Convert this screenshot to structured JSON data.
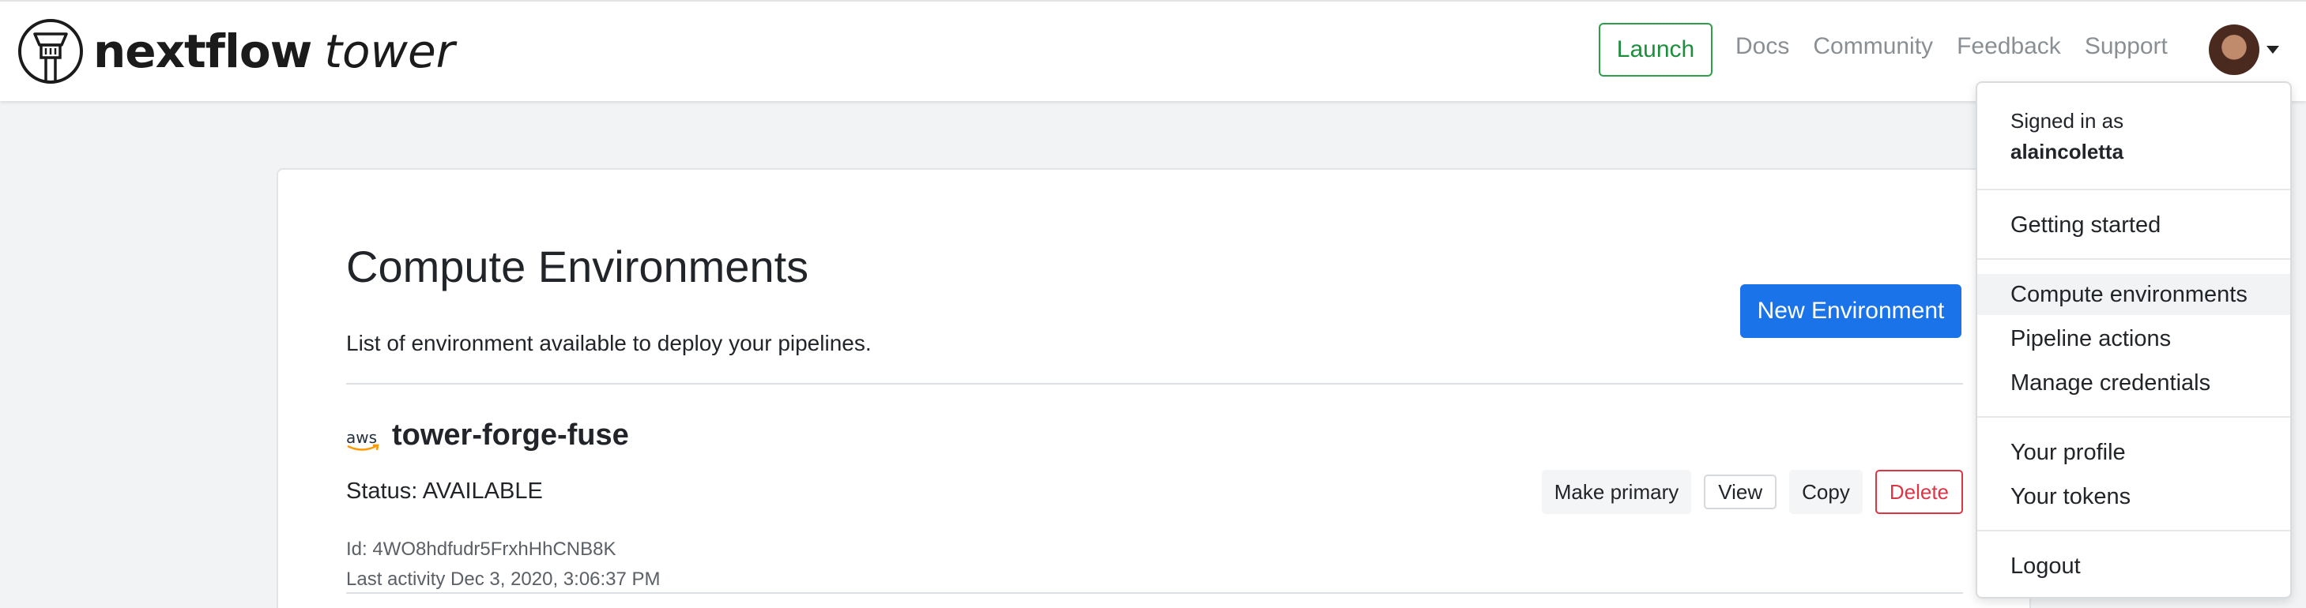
{
  "header": {
    "brand_name": "nextflow",
    "brand_sub": "tower",
    "launch_label": "Launch",
    "nav": [
      "Docs",
      "Community",
      "Feedback",
      "Support"
    ]
  },
  "main": {
    "title": "Compute Environments",
    "subtitle": "List of environment available to deploy your pipelines.",
    "new_button": "New Environment",
    "environments": [
      {
        "provider_icon": "aws-icon",
        "provider_label": "aws",
        "name": "tower-forge-fuse",
        "status": "Status: AVAILABLE",
        "id": "Id: 4WO8hdfudr5FrxhHhCNB8K",
        "last_activity": "Last activity Dec 3, 2020, 3:06:37 PM",
        "actions": {
          "make_primary": "Make primary",
          "view": "View",
          "copy": "Copy",
          "delete": "Delete"
        }
      }
    ]
  },
  "user_menu": {
    "signed_in_as": "Signed in as",
    "username": "alaincoletta",
    "items": [
      "Getting started",
      "Compute environments",
      "Pipeline actions",
      "Manage credentials",
      "Your profile",
      "Your tokens",
      "Logout"
    ],
    "active_item": "Compute environments"
  },
  "colors": {
    "launch": "#1e8e3e",
    "primary": "#1a73e8",
    "danger": "#dc3545",
    "page_bg": "#f1f3f5"
  }
}
